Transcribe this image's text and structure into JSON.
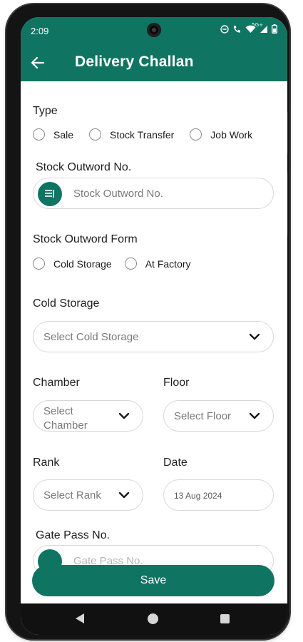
{
  "status_bar": {
    "time": "2:09",
    "network": "5G+"
  },
  "app_bar": {
    "title": "Delivery Challan"
  },
  "type_section": {
    "label": "Type",
    "options": [
      "Sale",
      "Stock Transfer",
      "Job Work"
    ]
  },
  "stock_outword_no": {
    "label": "Stock Outword No.",
    "placeholder": "Stock Outword No."
  },
  "stock_outword_form": {
    "label": "Stock Outword Form",
    "options": [
      "Cold Storage",
      "At Factory"
    ]
  },
  "cold_storage": {
    "label": "Cold Storage",
    "placeholder": "Select Cold Storage"
  },
  "chamber": {
    "label": "Chamber",
    "placeholder": "Select Chamber"
  },
  "floor": {
    "label": "Floor",
    "placeholder": "Select Floor"
  },
  "rank": {
    "label": "Rank",
    "placeholder": "Select Rank"
  },
  "date": {
    "label": "Date",
    "value": "13 Aug 2024"
  },
  "gate_pass_no": {
    "label": "Gate Pass No.",
    "placeholder": "Gate Pass No."
  },
  "actions": {
    "save_label": "Save"
  },
  "colors": {
    "primary": "#0f7562",
    "border": "#d7d7d7"
  }
}
